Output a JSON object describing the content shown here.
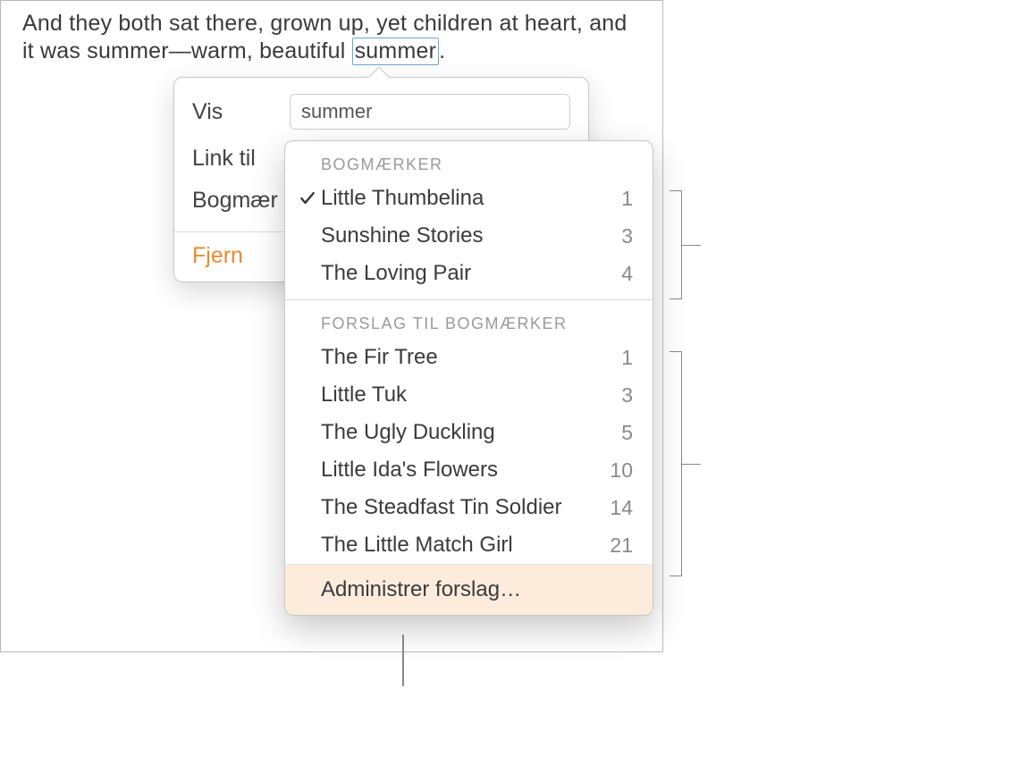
{
  "document": {
    "paragraph_before": "And they both sat there, grown up, yet children at heart, and it was summer—warm, beautiful ",
    "selected_word": "summer",
    "paragraph_after": "."
  },
  "link_popover": {
    "labels": {
      "show": "Vis",
      "link_to": "Link til",
      "bookmark": "Bogmær"
    },
    "show_value": "summer",
    "remove_label": "Fjern"
  },
  "dropdown": {
    "section_bookmarks_header": "BOGMÆRKER",
    "bookmarks": [
      {
        "label": "Little Thumbelina",
        "count": "1",
        "checked": true
      },
      {
        "label": "Sunshine Stories",
        "count": "3",
        "checked": false
      },
      {
        "label": "The Loving Pair",
        "count": "4",
        "checked": false
      }
    ],
    "section_suggestions_header": "FORSLAG TIL BOGMÆRKER",
    "suggestions": [
      {
        "label": "The Fir Tree",
        "count": "1"
      },
      {
        "label": "Little Tuk",
        "count": "3"
      },
      {
        "label": "The Ugly Duckling",
        "count": "5"
      },
      {
        "label": "Little Ida's Flowers",
        "count": "10"
      },
      {
        "label": "The Steadfast Tin Soldier",
        "count": "14"
      },
      {
        "label": "The Little Match Girl",
        "count": "21"
      }
    ],
    "manage_label": "Administrer forslag…"
  }
}
